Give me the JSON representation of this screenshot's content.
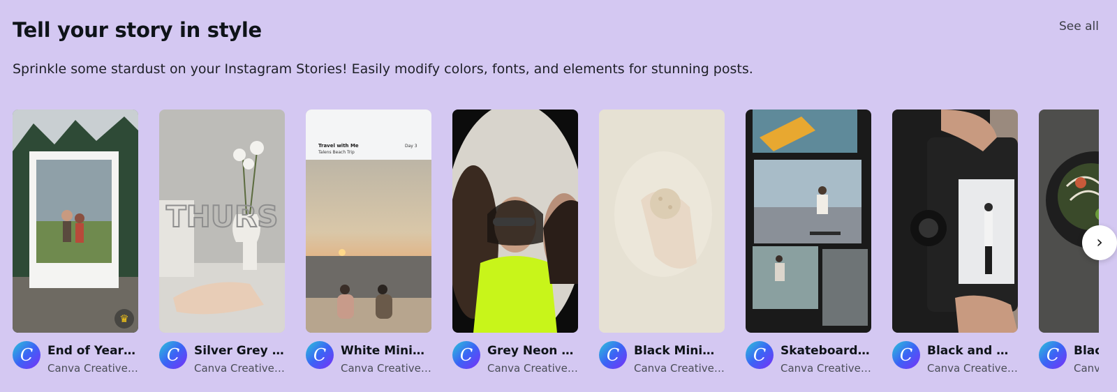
{
  "header": {
    "title": "Tell your story in style",
    "see_all": "See all",
    "subtitle": "Sprinkle some stardust on your Instagram Stories! Easily modify colors, fonts, and elements for stunning posts."
  },
  "cards": [
    {
      "title": "End of Year R...",
      "author": "Canva Creative ...",
      "premium": true
    },
    {
      "title": "Silver Grey E...",
      "author": "Canva Creative ..."
    },
    {
      "title": "White Minim...",
      "author": "Canva Creative ...",
      "overlay": {
        "heading": "Travel with Me",
        "sub": "Talens Beach Trip",
        "day": "Day 3"
      }
    },
    {
      "title": "Grey Neon Gr...",
      "author": "Canva Creative ..."
    },
    {
      "title": "Black Minima...",
      "author": "Canva Creative ..."
    },
    {
      "title": "Skateboarder...",
      "author": "Canva Creative ..."
    },
    {
      "title": "Black and Wh...",
      "author": "Canva Creative ..."
    },
    {
      "title": "Blac",
      "author": "Canva"
    }
  ],
  "avatar_glyph": "C",
  "icons": {
    "next": "chevron-right-icon",
    "crown": "crown-icon"
  },
  "colors": {
    "background": "#d4c8f2",
    "avatar_start": "#2bc4d8",
    "avatar_end": "#7b2ff7"
  }
}
